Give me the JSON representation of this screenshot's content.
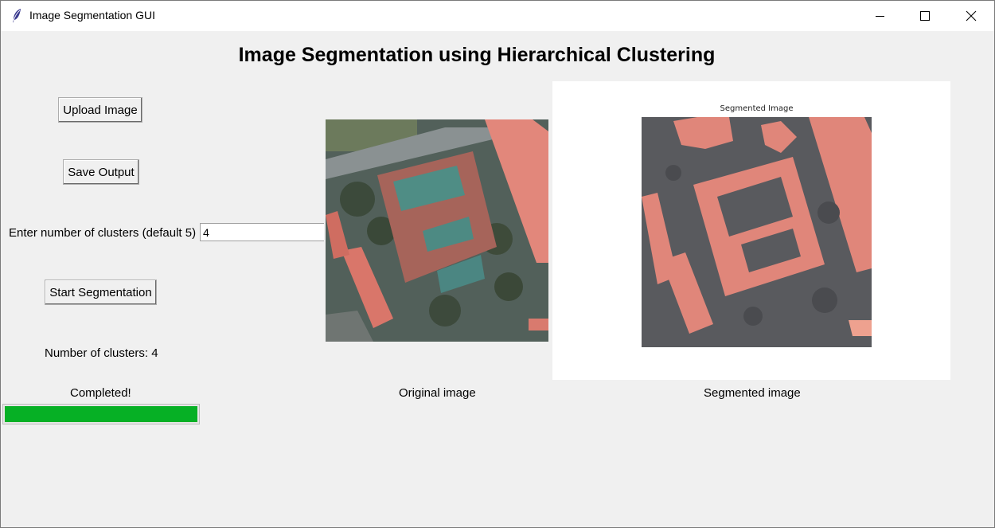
{
  "window": {
    "title": "Image Segmentation GUI",
    "controls": [
      "minimize-icon",
      "maximize-icon",
      "close-icon"
    ]
  },
  "heading": "Image Segmentation using Hierarchical Clustering",
  "buttons": {
    "upload": "Upload Image",
    "save": "Save Output",
    "start": "Start Segmentation"
  },
  "clusters": {
    "label": "Enter number of clusters (default 5)",
    "value": "4",
    "status": "Number of clusters: 4"
  },
  "progress": {
    "status": "Completed!",
    "fraction": 1.0,
    "color": "#06b025"
  },
  "images": {
    "original_caption": "Original image",
    "segmented_caption": "Segmented image",
    "plot_title": "Segmented Image"
  },
  "colors": {
    "segment_dark": "#595a5e",
    "segment_salmon": "#e0867a",
    "segment_light": "#eea18f"
  }
}
